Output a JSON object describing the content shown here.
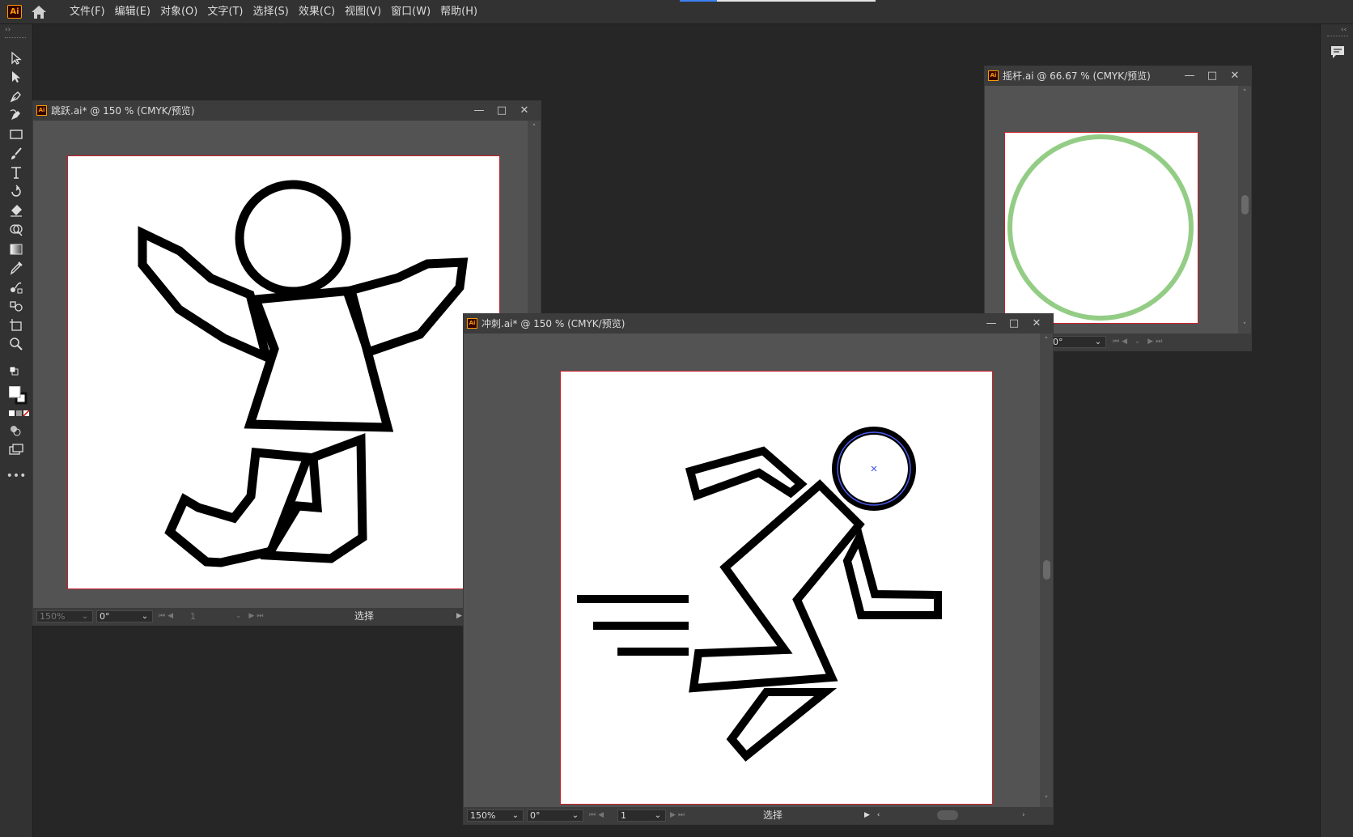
{
  "app": {
    "logo": "Ai"
  },
  "menu": [
    "文件(F)",
    "编辑(E)",
    "对象(O)",
    "文字(T)",
    "选择(S)",
    "效果(C)",
    "视图(V)",
    "窗口(W)",
    "帮助(H)"
  ],
  "toolbar": {
    "collapse_glyph": "››",
    "tools": [
      "selection-tool",
      "direct-selection-tool",
      "pen-tool",
      "curvature-tool",
      "rectangle-tool",
      "paintbrush-tool",
      "type-tool",
      "rotate-tool",
      "eraser-tool",
      "shape-builder-tool",
      "gradient-tool",
      "eyedropper-tool",
      "blend-tool",
      "symbol-sprayer-tool",
      "artboard-tool",
      "zoom-tool"
    ],
    "more": "•••"
  },
  "right_panel": {
    "collapse_glyph": "‹‹",
    "icon": "comments-icon"
  },
  "windows": {
    "jump": {
      "title": "跳跃.ai* @ 150 % (CMYK/预览)",
      "zoom": "150%",
      "angle": "0°",
      "page": "1",
      "tool": "选择",
      "controls": [
        "—",
        "□",
        "✕"
      ]
    },
    "sprint": {
      "title": "冲刺.ai* @ 150 % (CMYK/预览)",
      "zoom": "150%",
      "angle": "0°",
      "page": "1",
      "tool": "选择",
      "controls": [
        "—",
        "□",
        "✕"
      ]
    },
    "joystick": {
      "title": "摇杆.ai @ 66.67 % (CMYK/预览)",
      "angle": "0°",
      "controls": [
        "—",
        "□",
        "✕"
      ],
      "circle_color": "#93cd85"
    }
  },
  "colors": {
    "artboard_border": "#c8202a",
    "selection_blue": "#4a5cf0"
  }
}
